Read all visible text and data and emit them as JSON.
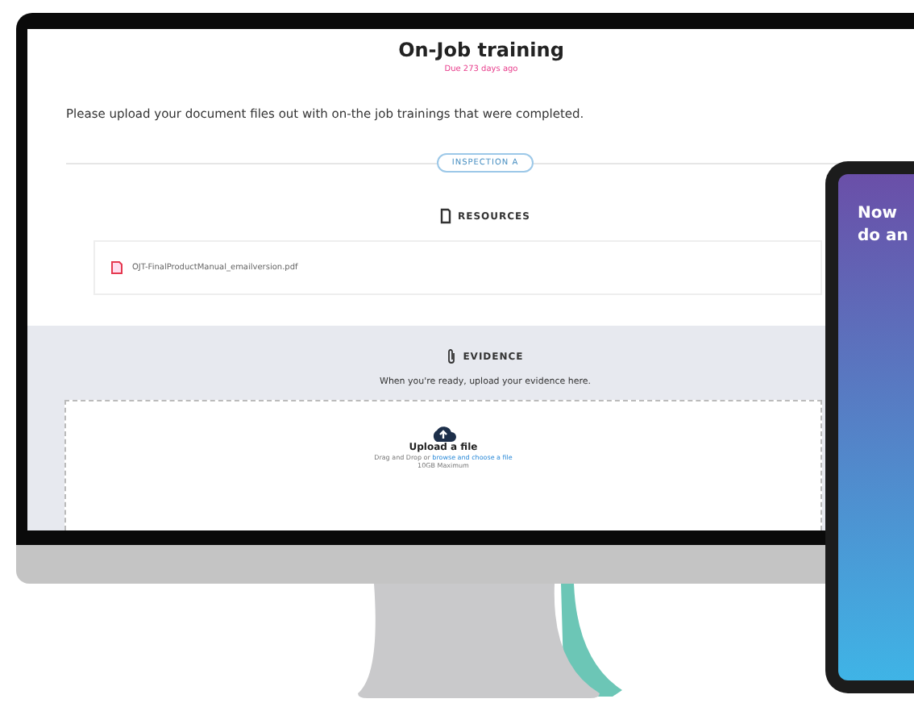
{
  "screen": {
    "title": "On-Job training",
    "due": "Due 273 days ago",
    "instructions": "Please upload your document files out with on-the job trainings that were completed.",
    "section_pill": "INSPECTION A",
    "resources": {
      "heading": "RESOURCES",
      "files": [
        "OJT-FinalProductManual_emailversion.pdf"
      ]
    },
    "evidence": {
      "heading": "EVIDENCE",
      "prompt": "When you're ready, upload your evidence here.",
      "upload_title": "Upload a file",
      "upload_hint": "Drag and Drop or ",
      "upload_link": "browse and choose a file",
      "upload_limit": "10GB Maximum"
    }
  },
  "phone": {
    "heading_lines": [
      "Now",
      "do an"
    ]
  }
}
